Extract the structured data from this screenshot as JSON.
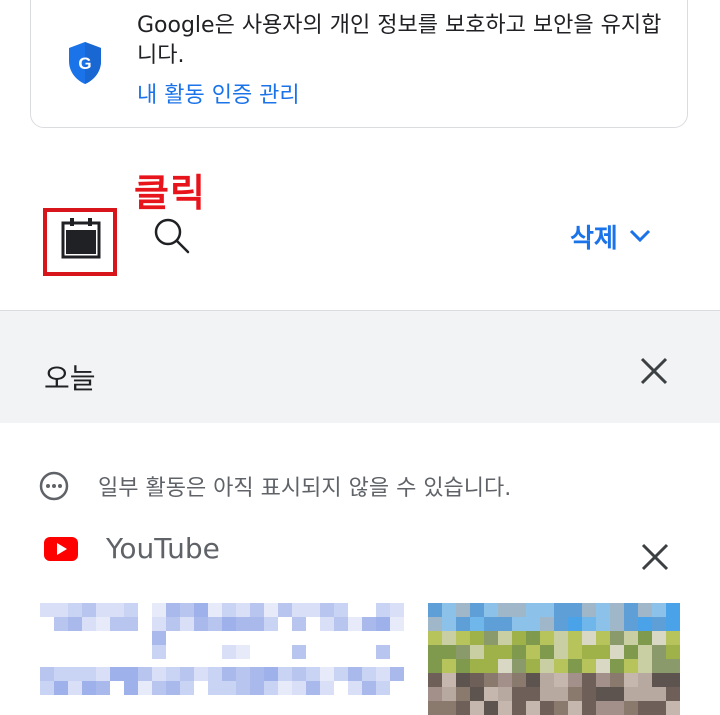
{
  "privacy_card": {
    "message": "Google은 사용자의 개인 정보를 보호하고 보안을 유지합니다.",
    "link": "내 활동 인증 관리"
  },
  "annotation": {
    "label": "클릭",
    "color": "#e8141b"
  },
  "toolbar": {
    "calendar_icon": "calendar-icon",
    "search_icon": "search-icon",
    "delete_label": "삭제"
  },
  "today": {
    "label": "오늘"
  },
  "notice": {
    "text": "일부 활동은 아직 표시되지 않을 수 있습니다."
  },
  "activity": {
    "app_name": "YouTube",
    "app_color": "#ff0000"
  },
  "colors": {
    "link": "#1a73e8",
    "section_bg": "#f1f3f4"
  }
}
